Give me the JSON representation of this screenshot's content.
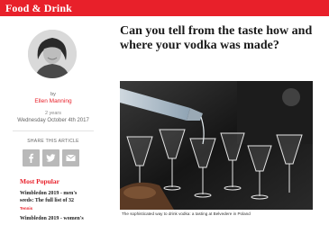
{
  "header": {
    "section": "Food & Drink"
  },
  "article": {
    "headline": "Can you tell from the taste how and where your vodka was made?",
    "caption": "The sophisticated way to drink vodka: a tasting at Belvedere in Poland"
  },
  "author": {
    "by": "by",
    "name": "Ellen Manning",
    "ago": "2 years",
    "date": "Wednesday October 4th 2017"
  },
  "share": {
    "label": "SHARE THIS ARTICLE",
    "buttons": [
      {
        "icon": "facebook-icon"
      },
      {
        "icon": "twitter-icon"
      },
      {
        "icon": "email-icon"
      }
    ]
  },
  "popular": {
    "title": "Most Popular",
    "items": [
      {
        "title": "Wimbledon 2019 - men's seeds: The full list of 32",
        "tag": "Tennis"
      },
      {
        "title": "Wimbledon 2019 - women's"
      }
    ]
  },
  "colors": {
    "accent": "#e8202a"
  }
}
